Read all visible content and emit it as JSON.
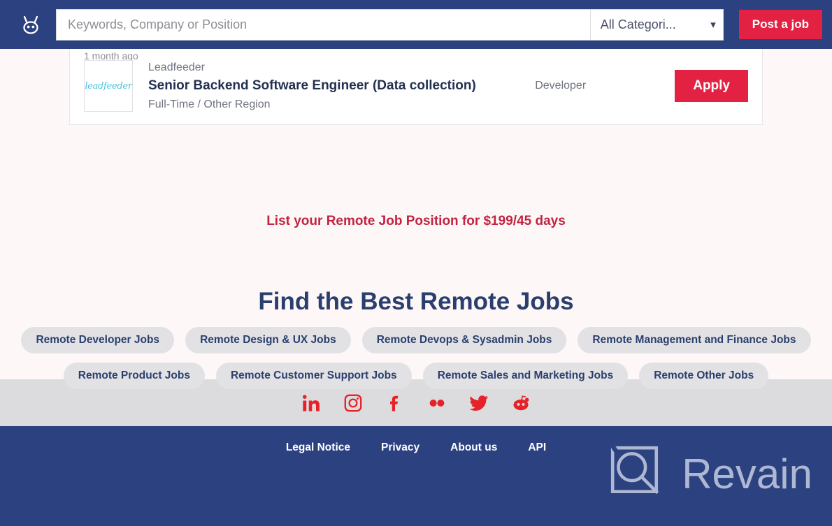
{
  "header": {
    "logo_icon": "robot-head-icon",
    "search": {
      "placeholder": "Keywords, Company or Position",
      "value": ""
    },
    "category_select": {
      "selected": "All Categori...",
      "caret_icon": "chevron-down-icon"
    },
    "post_job_label": "Post a job",
    "bg_color": "#2b4180",
    "accent_color": "#e32142"
  },
  "job_card": {
    "posted_ago": "1 month ago",
    "logo_text": "leadfeeder",
    "company": "Leadfeeder",
    "title": "Senior Backend Software Engineer (Data collection)",
    "meta": "Full-Time / Other Region",
    "category": "Developer",
    "apply_label": "Apply"
  },
  "promo": {
    "text": "List your Remote Job Position for $199/45 days",
    "color": "#c22342"
  },
  "find_section": {
    "title": "Find the Best Remote Jobs",
    "title_color": "#2b3f6e",
    "tags": [
      {
        "label": "Remote Developer Jobs"
      },
      {
        "label": "Remote Design & UX Jobs"
      },
      {
        "label": "Remote Devops & Sysadmin Jobs"
      },
      {
        "label": "Remote Management and Finance Jobs"
      },
      {
        "label": "Remote Product Jobs"
      },
      {
        "label": "Remote Customer Support Jobs"
      },
      {
        "label": "Remote Sales and Marketing Jobs"
      },
      {
        "label": "Remote Other Jobs"
      }
    ]
  },
  "social": {
    "bg_color": "#dcdcde",
    "icon_color": "#e62229",
    "items": [
      {
        "name": "linkedin-icon"
      },
      {
        "name": "instagram-icon"
      },
      {
        "name": "facebook-icon"
      },
      {
        "name": "flickr-icon"
      },
      {
        "name": "twitter-icon"
      },
      {
        "name": "reddit-icon"
      }
    ]
  },
  "footer": {
    "bg_color": "#2b4180",
    "links": [
      {
        "label": "Legal Notice"
      },
      {
        "label": "Privacy"
      },
      {
        "label": "About us"
      },
      {
        "label": "API"
      }
    ],
    "brand_name": "Revain",
    "brand_icon": "revain-logo-icon",
    "brand_color": "#aeb8d2"
  }
}
